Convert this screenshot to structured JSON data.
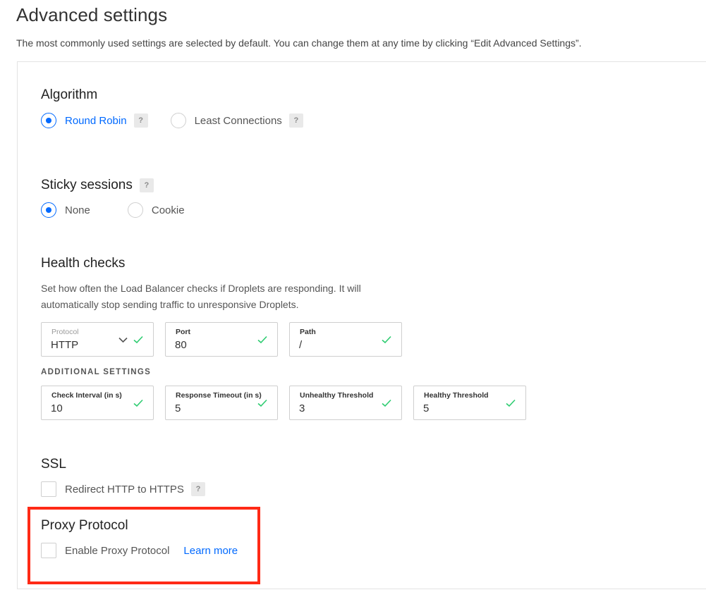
{
  "header": {
    "title": "Advanced settings",
    "subtitle": "The most commonly used settings are selected by default. You can change them at any time by clicking “Edit Advanced Settings”."
  },
  "algorithm": {
    "title": "Algorithm",
    "options": [
      {
        "label": "Round Robin",
        "selected": true
      },
      {
        "label": "Least Connections",
        "selected": false
      }
    ],
    "help_label": "?"
  },
  "sticky_sessions": {
    "title": "Sticky sessions",
    "help_label": "?",
    "options": [
      {
        "label": "None",
        "selected": true
      },
      {
        "label": "Cookie",
        "selected": false
      }
    ]
  },
  "health_checks": {
    "title": "Health checks",
    "description_line1": "Set how often the Load Balancer checks if Droplets are responding. It will",
    "description_line2": "automatically stop sending traffic to unresponsive Droplets.",
    "fields": {
      "protocol": {
        "label": "Protocol",
        "value": "HTTP"
      },
      "port": {
        "label": "Port",
        "value": "80"
      },
      "path": {
        "label": "Path",
        "value": "/"
      }
    },
    "additional_settings_label": "ADDITIONAL SETTINGS",
    "additional": {
      "check_interval": {
        "label": "Check Interval (in s)",
        "value": "10"
      },
      "response_timeout": {
        "label": "Response Timeout (in s)",
        "value": "5"
      },
      "unhealthy_threshold": {
        "label": "Unhealthy Threshold",
        "value": "3"
      },
      "healthy_threshold": {
        "label": "Healthy Threshold",
        "value": "5"
      }
    }
  },
  "ssl": {
    "title": "SSL",
    "redirect_label": "Redirect HTTP to HTTPS",
    "redirect_checked": false,
    "help_label": "?"
  },
  "proxy_protocol": {
    "title": "Proxy Protocol",
    "enable_label": "Enable Proxy Protocol",
    "enable_checked": false,
    "learn_more": "Learn more"
  },
  "colors": {
    "accent": "#0069ff",
    "valid": "#2ecc71",
    "highlight": "#ff2a16"
  },
  "icons": {
    "valid": "check-icon",
    "dropdown": "chevron-down-icon",
    "help": "help-icon"
  }
}
